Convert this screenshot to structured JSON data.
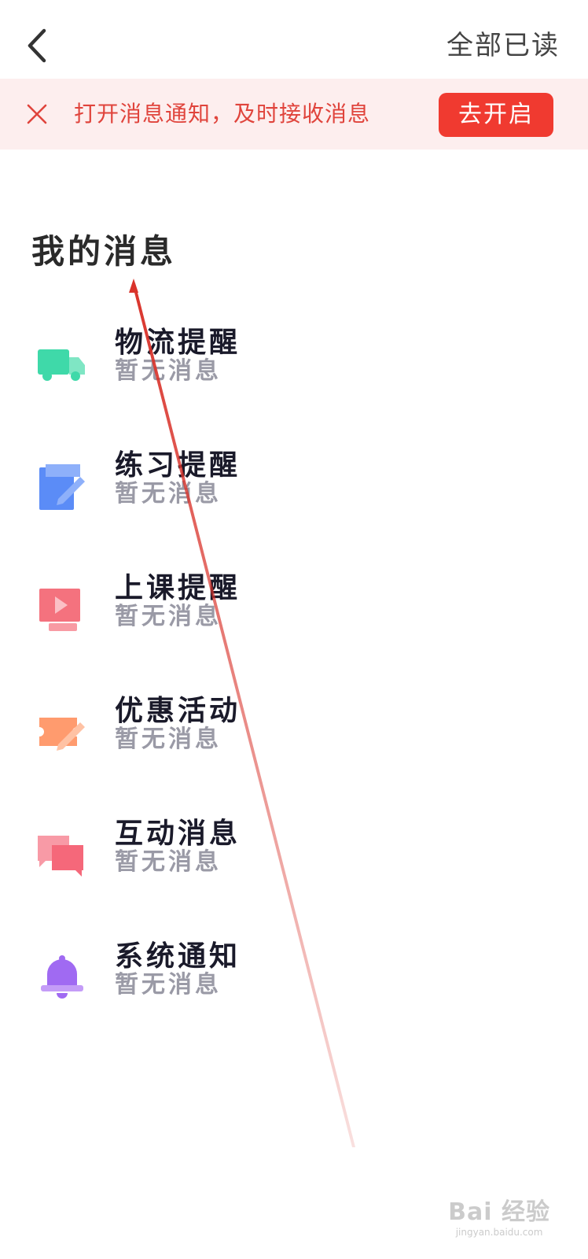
{
  "navbar": {
    "back_icon": "chevron-left-icon",
    "mark_all_read_label": "全部已读"
  },
  "banner": {
    "close_icon": "close-icon",
    "text": "打开消息通知，及时接收消息",
    "button_label": "去开启",
    "accent_color": "#f03a30",
    "background_color": "#fdeeee"
  },
  "section": {
    "title": "我的消息"
  },
  "messages": [
    {
      "title": "物流提醒",
      "subtitle": "暂无消息",
      "icon": "truck-icon",
      "color": "#3fd9a9"
    },
    {
      "title": "练习提醒",
      "subtitle": "暂无消息",
      "icon": "note-edit-icon",
      "color": "#5b8cf7"
    },
    {
      "title": "上课提醒",
      "subtitle": "暂无消息",
      "icon": "video-play-icon",
      "color": "#f4727e"
    },
    {
      "title": "优惠活动",
      "subtitle": "暂无消息",
      "icon": "coupon-ticket-icon",
      "color": "#ff9b6e"
    },
    {
      "title": "互动消息",
      "subtitle": "暂无消息",
      "icon": "chat-bubbles-icon",
      "color": "#f5687a"
    },
    {
      "title": "系统通知",
      "subtitle": "暂无消息",
      "icon": "bell-icon",
      "color": "#a06af2"
    }
  ],
  "watermark": {
    "brand": "Bai 经验",
    "url": "jingyan.baidu.com"
  }
}
